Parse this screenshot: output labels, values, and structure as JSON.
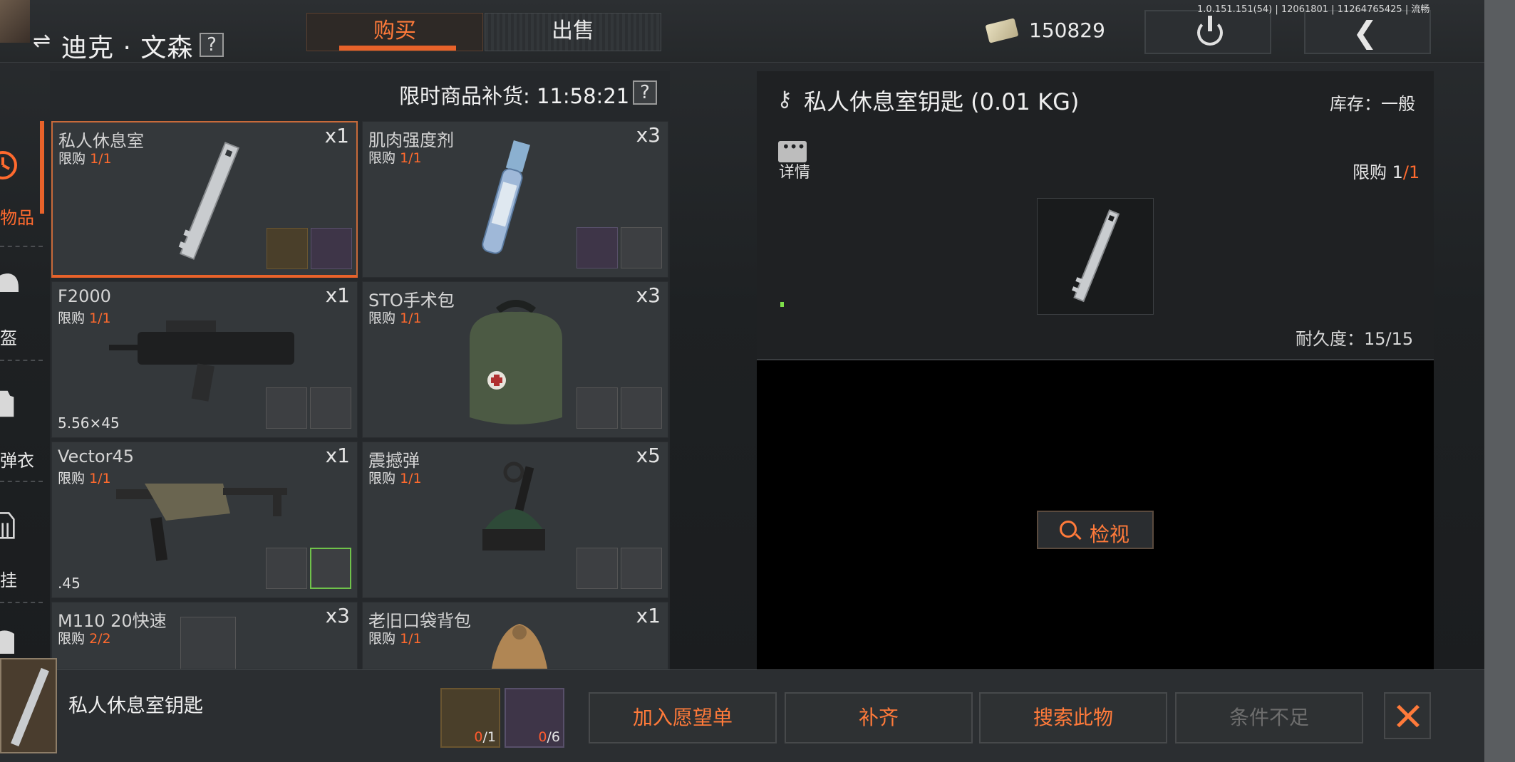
{
  "version": "1.0.151.151(54) | 12061801 | 11264765425 | 流畅",
  "trader": {
    "switch_icon": "⇌",
    "name": "迪克 · 文森",
    "help": "?"
  },
  "tabs": [
    {
      "label": "购买"
    },
    {
      "label": "出售"
    }
  ],
  "currency": {
    "icon": "cash-icon",
    "value": "150829"
  },
  "sidebar": {
    "items": [
      {
        "label": "物品",
        "icon": "clock-icon",
        "active": true
      },
      {
        "label": "盔",
        "icon": "helmet-icon"
      },
      {
        "label": "弹衣",
        "icon": "vest-icon"
      },
      {
        "label": "挂",
        "icon": "rig-icon"
      }
    ]
  },
  "restock": {
    "label": "限时商品补货: 11:58:21",
    "help": "?"
  },
  "limit_prefix": "限购",
  "items": [
    {
      "name": "私人休息室",
      "limit": "1/1",
      "qty": "x1",
      "caliber": ""
    },
    {
      "name": "肌肉强度剂",
      "limit": "1/1",
      "qty": "x3",
      "caliber": ""
    },
    {
      "name": "F2000",
      "limit": "1/1",
      "qty": "x1",
      "caliber": "5.56×45"
    },
    {
      "name": "STO手术包",
      "limit": "1/1",
      "qty": "x3",
      "caliber": ""
    },
    {
      "name": "Vector45",
      "limit": "1/1",
      "qty": "x1",
      "caliber": ".45"
    },
    {
      "name": "震撼弹",
      "limit": "1/1",
      "qty": "x5",
      "caliber": ""
    },
    {
      "name": "M110 20快速",
      "limit": "2/2",
      "qty": "x3",
      "caliber": ""
    },
    {
      "name": "老旧口袋背包",
      "limit": "1/1",
      "qty": "x1",
      "caliber": ""
    }
  ],
  "detail": {
    "title": "私人休息室钥匙 (0.01 KG)",
    "stock_label": "库存：",
    "stock_value": "一般",
    "details_label": "详情",
    "limit_label": "限购",
    "limit_have": "1",
    "limit_total": "/1",
    "durability": "耐久度：15/15",
    "inspect_label": "检视"
  },
  "bottom": {
    "selected_name": "私人休息室钥匙",
    "req1": {
      "have": "0",
      "total": "/1"
    },
    "req2": {
      "have": "0",
      "total": "/6"
    },
    "buttons": {
      "wishlist": "加入愿望单",
      "fill": "补齐",
      "search": "搜索此物",
      "insufficient": "条件不足"
    }
  },
  "colors": {
    "accent": "#e8622a",
    "limit_num": "#ff6a2e",
    "ok": "#6fc24a"
  }
}
